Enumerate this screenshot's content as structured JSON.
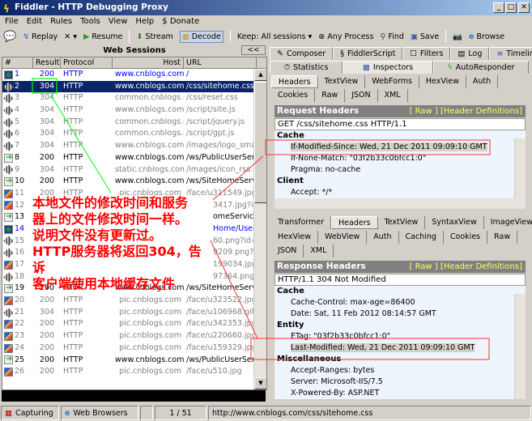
{
  "window": {
    "title": "Fiddler - HTTP Debugging Proxy",
    "controls": [
      "_",
      "□",
      "✕"
    ]
  },
  "menu": [
    "File",
    "Edit",
    "Rules",
    "Tools",
    "View",
    "Help",
    "$ Donate"
  ],
  "toolbar": {
    "replay": "Replay",
    "remove": "✕ ▾",
    "resume": "Resume",
    "stream": "Stream",
    "decode": "Decode",
    "keep": "Keep: All sessions ▾",
    "process": "Any Process",
    "find": "Find",
    "save": "Save",
    "browse": "Browse"
  },
  "sessions": {
    "title": "Web Sessions",
    "collapse": "<<",
    "columns": [
      "#",
      "Result",
      "Protocol",
      "Host",
      "URL"
    ],
    "rows": [
      {
        "n": "1",
        "r": "200",
        "p": "HTTP",
        "h": "www.cnblogs.com",
        "u": "/",
        "s": "blue",
        "i": "globe"
      },
      {
        "n": "2",
        "r": "304",
        "p": "HTTP",
        "h": "www.cnblogs.com",
        "u": "/css/sitehome.css",
        "s": "sel",
        "i": "cache"
      },
      {
        "n": "3",
        "r": "304",
        "p": "HTTP",
        "h": "common.cnblogs.com",
        "u": "/css/reset.css",
        "s": "gray",
        "i": "cache"
      },
      {
        "n": "4",
        "r": "304",
        "p": "HTTP",
        "h": "www.cnblogs.com",
        "u": "/script/site.js",
        "s": "gray",
        "i": "cache"
      },
      {
        "n": "5",
        "r": "304",
        "p": "HTTP",
        "h": "common.cnblogs.com",
        "u": "/script/jquery.js",
        "s": "gray",
        "i": "cache"
      },
      {
        "n": "6",
        "r": "304",
        "p": "HTTP",
        "h": "common.cnblogs.com",
        "u": "/script/gpt.js",
        "s": "gray",
        "i": "cache"
      },
      {
        "n": "7",
        "r": "304",
        "p": "HTTP",
        "h": "www.cnblogs.com",
        "u": "/images/logo_small.gif",
        "s": "gray",
        "i": "cache"
      },
      {
        "n": "8",
        "r": "200",
        "p": "HTTP",
        "h": "www.cnblogs.com",
        "u": "/ws/PublicUserService",
        "s": "black",
        "i": "arrow"
      },
      {
        "n": "9",
        "r": "304",
        "p": "HTTP",
        "h": "static.cnblogs.com",
        "u": "/images/icon_rss.gif",
        "s": "gray",
        "i": "cache"
      },
      {
        "n": "10",
        "r": "200",
        "p": "HTTP",
        "h": "www.cnblogs.com",
        "u": "/ws/SiteHomeService",
        "s": "black",
        "i": "arrow"
      },
      {
        "n": "11",
        "r": "200",
        "p": "HTTP",
        "h": "pic.cnblogs.com",
        "u": "/face/u311549.jpg?id",
        "s": "gray",
        "i": "page"
      },
      {
        "n": "12",
        "r": "",
        "p": "",
        "h": "",
        "u": "3417.jpg?id",
        "s": "gray clip",
        "i": "page"
      },
      {
        "n": "13",
        "r": "",
        "p": "",
        "h": "",
        "u": "omeService",
        "s": "black clip",
        "i": "arrow"
      },
      {
        "n": "14",
        "r": "",
        "p": "",
        "h": "",
        "u": "Home/UserS",
        "s": "blue clip",
        "i": "globe"
      },
      {
        "n": "15",
        "r": "",
        "p": "",
        "h": "",
        "u": "60.png?id=",
        "s": "gray clip",
        "i": "cache"
      },
      {
        "n": "16",
        "r": "",
        "p": "",
        "h": "",
        "u": "9209.png?id",
        "s": "gray clip",
        "i": "cache"
      },
      {
        "n": "17",
        "r": "",
        "p": "",
        "h": "",
        "u": "199034.jpg?id",
        "s": "gray clip",
        "i": "page"
      },
      {
        "n": "18",
        "r": "",
        "p": "",
        "h": "",
        "u": "97364.png?id=",
        "s": "gray clip",
        "i": "cache"
      },
      {
        "n": "19",
        "r": "200",
        "p": "HTTP",
        "h": "www.cnblogs.com",
        "u": "/ws/SiteHomeService",
        "s": "black",
        "i": "arrow"
      },
      {
        "n": "20",
        "r": "200",
        "p": "HTTP",
        "h": "pic.cnblogs.com",
        "u": "/face/u323522.jpg?id",
        "s": "gray",
        "i": "page"
      },
      {
        "n": "21",
        "r": "304",
        "p": "HTTP",
        "h": "pic.cnblogs.com",
        "u": "/face/u106968.gif",
        "s": "gray",
        "i": "cache"
      },
      {
        "n": "22",
        "r": "200",
        "p": "HTTP",
        "h": "pic.cnblogs.com",
        "u": "/face/u342353.jpg?id",
        "s": "gray",
        "i": "page"
      },
      {
        "n": "23",
        "r": "200",
        "p": "HTTP",
        "h": "pic.cnblogs.com",
        "u": "/face/u220660.jpg?id",
        "s": "gray",
        "i": "page"
      },
      {
        "n": "24",
        "r": "200",
        "p": "HTTP",
        "h": "pic.cnblogs.com",
        "u": "/face/u159329.jpg",
        "s": "gray",
        "i": "page"
      },
      {
        "n": "25",
        "r": "200",
        "p": "HTTP",
        "h": "www.cnblogs.com",
        "u": "/ws/PublicUserService",
        "s": "black",
        "i": "arrow"
      },
      {
        "n": "26",
        "r": "200",
        "p": "HTTP",
        "h": "pic.cnblogs.com",
        "u": "/face/u510.jpg",
        "s": "gray",
        "i": "page"
      }
    ]
  },
  "annotation": [
    "本地文件的修改时间和服务",
    "器上的文件修改时间一样。",
    "说明文件没有更新过。",
    "HTTP服务器将返回304，告诉",
    "客户端使用本地缓存文件"
  ],
  "tabs": {
    "row1": [
      "Composer",
      "FiddlerScript",
      "Filters",
      "Log",
      "Timeline"
    ],
    "row2": [
      "Statistics",
      "Inspectors",
      "AutoResponder"
    ],
    "active": "Inspectors"
  },
  "request": {
    "subtabs1": [
      "Headers",
      "TextView",
      "WebForms",
      "HexView",
      "Auth"
    ],
    "subtabs2": [
      "Cookies",
      "Raw",
      "JSON",
      "XML"
    ],
    "title": "Request Headers",
    "links": "[ Raw ]   [Header Definitions]",
    "first_line": "GET /css/sitehome.css HTTP/1.1",
    "groups": [
      {
        "name": "Cache",
        "lines": [
          "If-Modified-Since: Wed, 21 Dec 2011 09:09:10 GMT",
          "If-None-Match: \"03f2b33c0bfcc1:0\"",
          "Pragma: no-cache"
        ]
      },
      {
        "name": "Client",
        "lines": [
          "Accept: */*"
        ]
      }
    ]
  },
  "response": {
    "subtabs1": [
      "Transformer",
      "Headers",
      "TextView",
      "SyntaxView",
      "ImageView"
    ],
    "subtabs2": [
      "HexView",
      "WebView",
      "Auth",
      "Caching",
      "Cookies",
      "Raw"
    ],
    "subtabs3": [
      "JSON",
      "XML"
    ],
    "title": "Response Headers",
    "links": "[ Raw ]   [Header Definitions]",
    "first_line": "HTTP/1.1 304 Not Modified",
    "groups": [
      {
        "name": "Cache",
        "lines": [
          "Cache-Control: max-age=86400",
          "Date: Sat, 11 Feb 2012 08:14:57 GMT"
        ]
      },
      {
        "name": "Entity",
        "lines": [
          "ETag: \"03f2b33c0bfcc1:0\"",
          "Last-Modified: Wed, 21 Dec 2011 09:09:10 GMT"
        ]
      },
      {
        "name": "Miscellaneous",
        "lines": [
          "Accept-Ranges: bytes",
          "Server: Microsoft-IIS/7.5",
          "X-Powered-By: ASP.NET"
        ]
      }
    ]
  },
  "status": {
    "capturing": "Capturing",
    "browsers": "Web Browsers",
    "count": "1 / 51",
    "url": "http://www.cnblogs.com/css/sitehome.css"
  },
  "colors": {
    "selection": "#0a246a",
    "annotation": "#ff0000",
    "highlight_line": "#00ff00"
  }
}
